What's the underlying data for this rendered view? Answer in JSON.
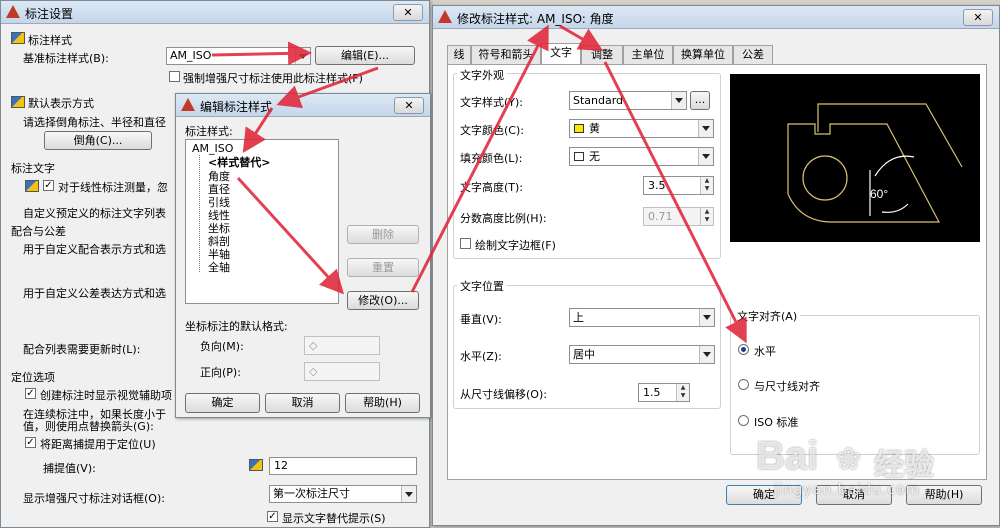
{
  "left_window": {
    "title": "标注设置",
    "close": "✕",
    "section_style": "标注样式",
    "base_style_label": "基准标注样式(B):",
    "base_style_value": "AM_ISO",
    "edit_button": "编辑(E)...",
    "force_checkbox": "强制增强尺寸标注使用此标注样式(F)",
    "section_display": "默认表示方式",
    "display_desc": "请选择倒角标注、半径和直径",
    "chamfer_button": "倒角(C)...",
    "section_text": "标注文字",
    "linear_checkbox": "对于线性标注测量，忽",
    "custom_text_desc": "自定义预定义的标注文字列表",
    "section_fit": "配合与公差",
    "fit_desc": "用于自定义配合表示方式和选",
    "tol_desc": "用于自定义公差表达方式和选",
    "fit_update": "配合列表需要更新时(L):",
    "section_locate": "定位选项",
    "visual_checkbox": "创建标注时显示视觉辅助项",
    "continuous_desc_1": "在连续标注中，如果长度小于",
    "continuous_desc_2": "值，则使用点替换箭头(G):",
    "promote_checkbox": "将距离捕提用于定位(U)",
    "snap_label": "捕提值(V):",
    "snap_value": "12",
    "enhanced_label": "显示增强尺寸标注对话框(O):",
    "enhanced_value": "第一次标注尺寸",
    "show_text_checkbox": "显示文字替代提示(S)"
  },
  "edit_dialog": {
    "title": "编辑标注样式",
    "close": "✕",
    "styles_label": "标注样式:",
    "tree": {
      "root": "AM_ISO",
      "override": "<样式替代>",
      "children": [
        "角度",
        "直径",
        "引线",
        "线性",
        "坐标",
        "斜剖",
        "半轴",
        "全轴"
      ]
    },
    "delete_button": "删除",
    "reset_button": "重置",
    "modify_button": "修改(O)...",
    "coord_label": "坐标标注的默认格式:",
    "negative_label": "负向(M):",
    "negative_value": "◇",
    "positive_label": "正向(P):",
    "positive_value": "◇",
    "ok_button": "确定",
    "cancel_button": "取消",
    "help_button": "帮助(H)"
  },
  "modify_dialog": {
    "title": "修改标注样式: AM_ISO: 角度",
    "close": "✕",
    "tabs": [
      "线",
      "符号和箭头",
      "文字",
      "调整",
      "主单位",
      "换算单位",
      "公差"
    ],
    "active_tab": "文字",
    "appearance": {
      "title": "文字外观",
      "style_label": "文字样式(Y):",
      "style_value": "Standard",
      "style_button": "...",
      "color_label": "文字颜色(C):",
      "color_value": "黄",
      "fill_label": "填充颜色(L):",
      "fill_value": "无",
      "height_label": "文字高度(T):",
      "height_value": "3.5",
      "fraction_label": "分数高度比例(H):",
      "fraction_value": "0.71",
      "frame_checkbox": "绘制文字边框(F)"
    },
    "placement": {
      "title": "文字位置",
      "vertical_label": "垂直(V):",
      "vertical_value": "上",
      "horizontal_label": "水平(Z):",
      "horizontal_value": "居中",
      "offset_label": "从尺寸线偏移(O):",
      "offset_value": "1.5"
    },
    "alignment": {
      "title": "文字对齐(A)",
      "options": [
        "水平",
        "与尺寸线对齐",
        "ISO 标准"
      ],
      "selected": "水平"
    },
    "preview_angle": "60°",
    "ok_button": "确定",
    "cancel_button": "取消",
    "help_button": "帮助(H)"
  },
  "watermark": {
    "brand": "Bai",
    "brand_cn": "经验",
    "url": "jingyan.baidu.com"
  },
  "colors": {
    "arrow": "#e0263a",
    "yellow": "#ffe600",
    "preview_bg": "#000000",
    "preview_line": "#d8c070"
  }
}
